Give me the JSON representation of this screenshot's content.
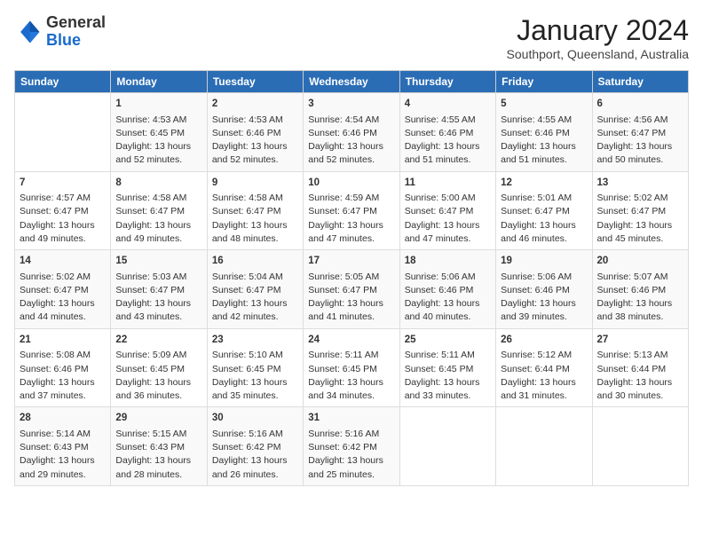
{
  "header": {
    "logo_line1": "General",
    "logo_line2": "Blue",
    "month": "January 2024",
    "location": "Southport, Queensland, Australia"
  },
  "days_of_week": [
    "Sunday",
    "Monday",
    "Tuesday",
    "Wednesday",
    "Thursday",
    "Friday",
    "Saturday"
  ],
  "weeks": [
    [
      {
        "day": "",
        "content": ""
      },
      {
        "day": "1",
        "sunrise": "Sunrise: 4:53 AM",
        "sunset": "Sunset: 6:45 PM",
        "daylight": "Daylight: 13 hours and 52 minutes."
      },
      {
        "day": "2",
        "sunrise": "Sunrise: 4:53 AM",
        "sunset": "Sunset: 6:46 PM",
        "daylight": "Daylight: 13 hours and 52 minutes."
      },
      {
        "day": "3",
        "sunrise": "Sunrise: 4:54 AM",
        "sunset": "Sunset: 6:46 PM",
        "daylight": "Daylight: 13 hours and 52 minutes."
      },
      {
        "day": "4",
        "sunrise": "Sunrise: 4:55 AM",
        "sunset": "Sunset: 6:46 PM",
        "daylight": "Daylight: 13 hours and 51 minutes."
      },
      {
        "day": "5",
        "sunrise": "Sunrise: 4:55 AM",
        "sunset": "Sunset: 6:46 PM",
        "daylight": "Daylight: 13 hours and 51 minutes."
      },
      {
        "day": "6",
        "sunrise": "Sunrise: 4:56 AM",
        "sunset": "Sunset: 6:47 PM",
        "daylight": "Daylight: 13 hours and 50 minutes."
      }
    ],
    [
      {
        "day": "7",
        "sunrise": "Sunrise: 4:57 AM",
        "sunset": "Sunset: 6:47 PM",
        "daylight": "Daylight: 13 hours and 49 minutes."
      },
      {
        "day": "8",
        "sunrise": "Sunrise: 4:58 AM",
        "sunset": "Sunset: 6:47 PM",
        "daylight": "Daylight: 13 hours and 49 minutes."
      },
      {
        "day": "9",
        "sunrise": "Sunrise: 4:58 AM",
        "sunset": "Sunset: 6:47 PM",
        "daylight": "Daylight: 13 hours and 48 minutes."
      },
      {
        "day": "10",
        "sunrise": "Sunrise: 4:59 AM",
        "sunset": "Sunset: 6:47 PM",
        "daylight": "Daylight: 13 hours and 47 minutes."
      },
      {
        "day": "11",
        "sunrise": "Sunrise: 5:00 AM",
        "sunset": "Sunset: 6:47 PM",
        "daylight": "Daylight: 13 hours and 47 minutes."
      },
      {
        "day": "12",
        "sunrise": "Sunrise: 5:01 AM",
        "sunset": "Sunset: 6:47 PM",
        "daylight": "Daylight: 13 hours and 46 minutes."
      },
      {
        "day": "13",
        "sunrise": "Sunrise: 5:02 AM",
        "sunset": "Sunset: 6:47 PM",
        "daylight": "Daylight: 13 hours and 45 minutes."
      }
    ],
    [
      {
        "day": "14",
        "sunrise": "Sunrise: 5:02 AM",
        "sunset": "Sunset: 6:47 PM",
        "daylight": "Daylight: 13 hours and 44 minutes."
      },
      {
        "day": "15",
        "sunrise": "Sunrise: 5:03 AM",
        "sunset": "Sunset: 6:47 PM",
        "daylight": "Daylight: 13 hours and 43 minutes."
      },
      {
        "day": "16",
        "sunrise": "Sunrise: 5:04 AM",
        "sunset": "Sunset: 6:47 PM",
        "daylight": "Daylight: 13 hours and 42 minutes."
      },
      {
        "day": "17",
        "sunrise": "Sunrise: 5:05 AM",
        "sunset": "Sunset: 6:47 PM",
        "daylight": "Daylight: 13 hours and 41 minutes."
      },
      {
        "day": "18",
        "sunrise": "Sunrise: 5:06 AM",
        "sunset": "Sunset: 6:46 PM",
        "daylight": "Daylight: 13 hours and 40 minutes."
      },
      {
        "day": "19",
        "sunrise": "Sunrise: 5:06 AM",
        "sunset": "Sunset: 6:46 PM",
        "daylight": "Daylight: 13 hours and 39 minutes."
      },
      {
        "day": "20",
        "sunrise": "Sunrise: 5:07 AM",
        "sunset": "Sunset: 6:46 PM",
        "daylight": "Daylight: 13 hours and 38 minutes."
      }
    ],
    [
      {
        "day": "21",
        "sunrise": "Sunrise: 5:08 AM",
        "sunset": "Sunset: 6:46 PM",
        "daylight": "Daylight: 13 hours and 37 minutes."
      },
      {
        "day": "22",
        "sunrise": "Sunrise: 5:09 AM",
        "sunset": "Sunset: 6:45 PM",
        "daylight": "Daylight: 13 hours and 36 minutes."
      },
      {
        "day": "23",
        "sunrise": "Sunrise: 5:10 AM",
        "sunset": "Sunset: 6:45 PM",
        "daylight": "Daylight: 13 hours and 35 minutes."
      },
      {
        "day": "24",
        "sunrise": "Sunrise: 5:11 AM",
        "sunset": "Sunset: 6:45 PM",
        "daylight": "Daylight: 13 hours and 34 minutes."
      },
      {
        "day": "25",
        "sunrise": "Sunrise: 5:11 AM",
        "sunset": "Sunset: 6:45 PM",
        "daylight": "Daylight: 13 hours and 33 minutes."
      },
      {
        "day": "26",
        "sunrise": "Sunrise: 5:12 AM",
        "sunset": "Sunset: 6:44 PM",
        "daylight": "Daylight: 13 hours and 31 minutes."
      },
      {
        "day": "27",
        "sunrise": "Sunrise: 5:13 AM",
        "sunset": "Sunset: 6:44 PM",
        "daylight": "Daylight: 13 hours and 30 minutes."
      }
    ],
    [
      {
        "day": "28",
        "sunrise": "Sunrise: 5:14 AM",
        "sunset": "Sunset: 6:43 PM",
        "daylight": "Daylight: 13 hours and 29 minutes."
      },
      {
        "day": "29",
        "sunrise": "Sunrise: 5:15 AM",
        "sunset": "Sunset: 6:43 PM",
        "daylight": "Daylight: 13 hours and 28 minutes."
      },
      {
        "day": "30",
        "sunrise": "Sunrise: 5:16 AM",
        "sunset": "Sunset: 6:42 PM",
        "daylight": "Daylight: 13 hours and 26 minutes."
      },
      {
        "day": "31",
        "sunrise": "Sunrise: 5:16 AM",
        "sunset": "Sunset: 6:42 PM",
        "daylight": "Daylight: 13 hours and 25 minutes."
      },
      {
        "day": "",
        "content": ""
      },
      {
        "day": "",
        "content": ""
      },
      {
        "day": "",
        "content": ""
      }
    ]
  ]
}
